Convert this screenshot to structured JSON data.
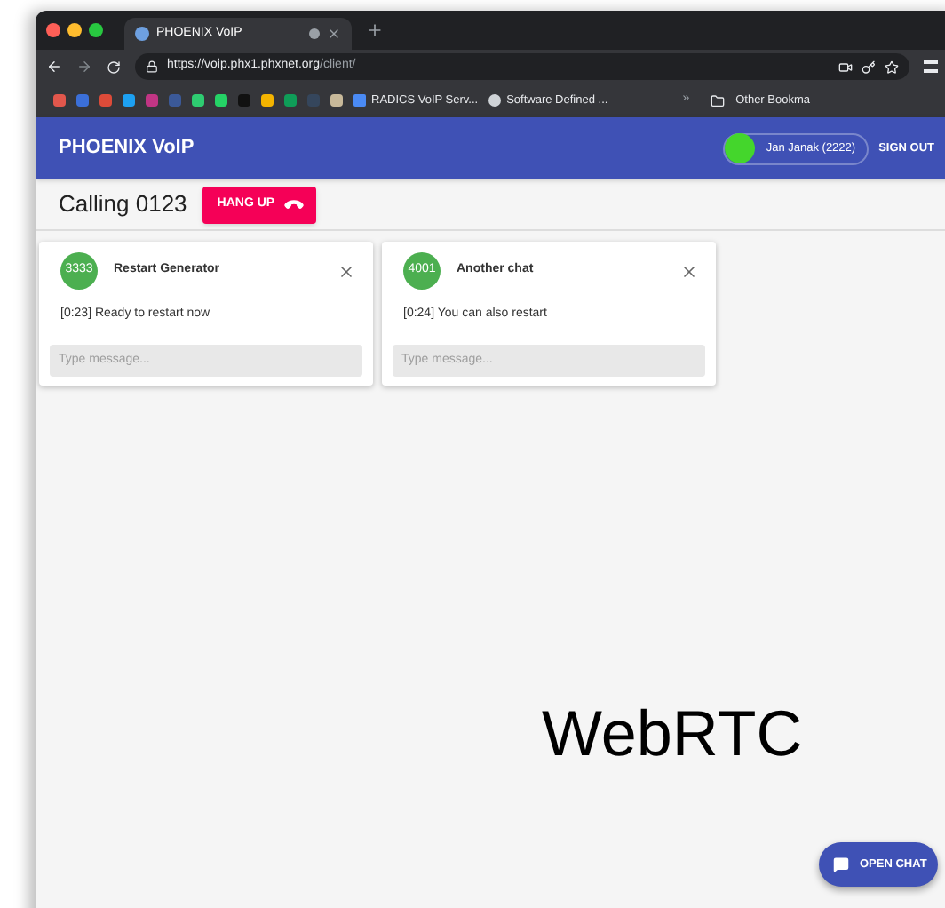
{
  "browser": {
    "tab_title": "PHOENIX VoIP",
    "url_host": "https://voip.phx1.phxnet.org",
    "url_path": "/client/",
    "bookmarks": [
      "RADICS VoIP Serv...",
      "Software Defined ..."
    ],
    "more_bookmarks": "»",
    "other_bookmarks": "Other Bookma"
  },
  "app_bar": {
    "title": "PHOENIX VoIP",
    "user": "Jan Janak (2222)",
    "online": true,
    "sign_out": "SIGN OUT"
  },
  "call": {
    "status": "Calling 0123",
    "hang_up": "HANG UP"
  },
  "chats": [
    {
      "number": "3333",
      "title": "Restart Generator",
      "message": "[0:23] Ready to restart now",
      "placeholder": "Type message..."
    },
    {
      "number": "4001",
      "title": "Another chat",
      "message": "[0:24] You can also restart",
      "placeholder": "Type message..."
    }
  ],
  "caption": "WebRTC",
  "open_chat": "OPEN CHAT"
}
